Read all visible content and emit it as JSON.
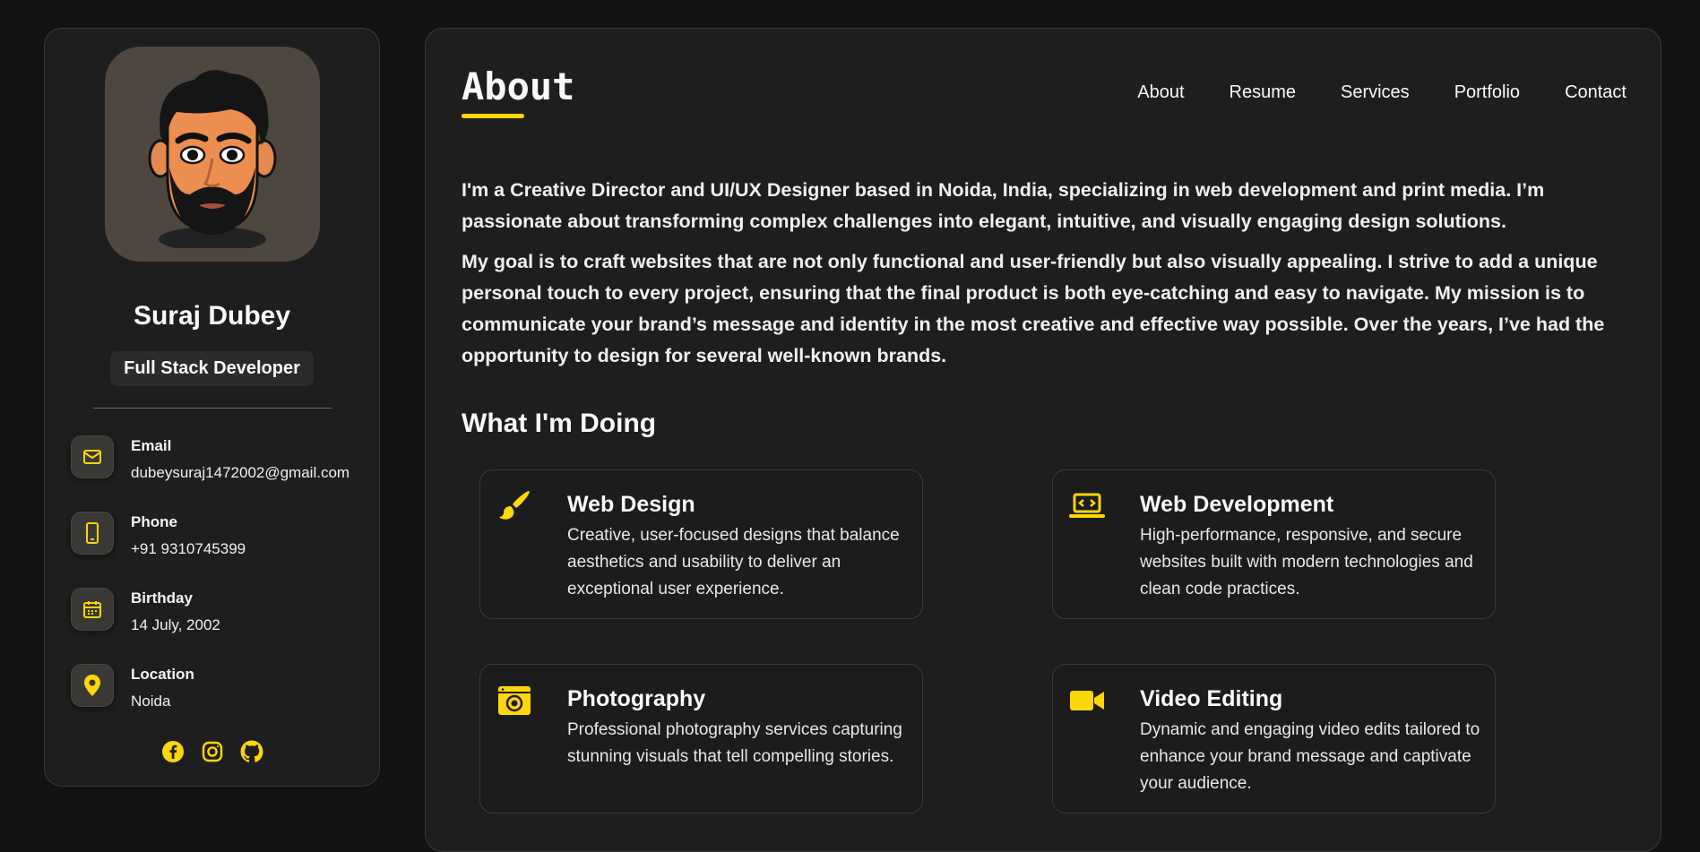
{
  "profile": {
    "name": "Suraj Dubey",
    "title": "Full Stack Developer"
  },
  "contacts": [
    {
      "label": "Email",
      "value": "dubeysuraj1472002@gmail.com",
      "icon": "mail-icon"
    },
    {
      "label": "Phone",
      "value": "+91 9310745399",
      "icon": "phone-icon"
    },
    {
      "label": "Birthday",
      "value": "14 July, 2002",
      "icon": "calendar-icon"
    },
    {
      "label": "Location",
      "value": "Noida",
      "icon": "location-pin-icon"
    }
  ],
  "socials": [
    "facebook-icon",
    "instagram-icon",
    "github-icon"
  ],
  "page": {
    "title": "About"
  },
  "nav": [
    "About",
    "Resume",
    "Services",
    "Portfolio",
    "Contact"
  ],
  "about": {
    "p1": "I'm a Creative Director and UI/UX Designer based in Noida, India, specializing in web development and print media. I’m passionate about transforming complex challenges into elegant, intuitive, and visually engaging design solutions.",
    "p2": "My goal is to craft websites that are not only functional and user-friendly but also visually appealing. I strive to add a unique personal touch to every project, ensuring that the final product is both eye-catching and easy to navigate. My mission is to communicate your brand’s message and identity in the most creative and effective way possible. Over the years, I’ve had the opportunity to design for several well-known brands."
  },
  "services_title": "What I'm Doing",
  "services": [
    {
      "title": "Web Design",
      "desc": "Creative, user-focused designs that balance aesthetics and usability to deliver an exceptional user experience.",
      "icon": "paintbrush-icon"
    },
    {
      "title": "Web Development",
      "desc": "High-performance, responsive, and secure websites built with modern technologies and clean code practices.",
      "icon": "laptop-code-icon"
    },
    {
      "title": "Photography",
      "desc": "Professional photography services capturing stunning visuals that tell compelling stories.",
      "icon": "camera-icon"
    },
    {
      "title": "Video Editing",
      "desc": "Dynamic and engaging video edits tailored to enhance your brand message and captivate your audience.",
      "icon": "video-camera-icon"
    }
  ],
  "colors": {
    "accent": "#ffd60a",
    "background": "#121212",
    "card": "#1e1e1f"
  }
}
